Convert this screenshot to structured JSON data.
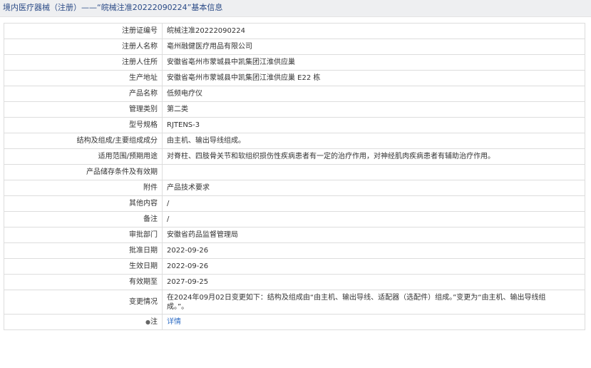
{
  "header": {
    "title": "境内医疗器械（注册）——“皖械注准20222090224”基本信息"
  },
  "rows": [
    {
      "label": "注册证编号",
      "value": "皖械注准20222090224"
    },
    {
      "label": "注册人名称",
      "value": "亳州融健医疗用品有限公司"
    },
    {
      "label": "注册人住所",
      "value": "安徽省亳州市蒙城县中凯集团江淮供应巢"
    },
    {
      "label": "生产地址",
      "value": "安徽省亳州市蒙城县中凯集团江淮供应巢 E22 栋"
    },
    {
      "label": "产品名称",
      "value": "低频电疗仪"
    },
    {
      "label": "管理类别",
      "value": "第二类"
    },
    {
      "label": "型号规格",
      "value": "RJTENS-3"
    },
    {
      "label": "结构及组成/主要组成成分",
      "value": "由主机、输出导线组成。"
    },
    {
      "label": "适用范围/预期用途",
      "value": "对脊柱、四肢骨关节和软组织损伤性疾病患者有一定的治疗作用，对神经肌肉疾病患者有辅助治疗作用。"
    },
    {
      "label": "产品储存条件及有效期",
      "value": ""
    },
    {
      "label": "附件",
      "value": "产品技术要求"
    },
    {
      "label": "其他内容",
      "value": "/"
    },
    {
      "label": "备注",
      "value": "/"
    },
    {
      "label": "审批部门",
      "value": "安徽省药品监督管理局"
    },
    {
      "label": "批准日期",
      "value": "2022-09-26"
    },
    {
      "label": "生效日期",
      "value": "2022-09-26"
    },
    {
      "label": "有效期至",
      "value": "2027-09-25"
    },
    {
      "label": "变更情况",
      "value": "在2024年09月02日变更如下：结构及组成由“由主机、输出导线、适配器（选配件）组成。”变更为“由主机、输出导线组成。”。"
    }
  ],
  "note_row": {
    "icon": "map-pin-icon",
    "label": "注",
    "link_text": "详情"
  }
}
